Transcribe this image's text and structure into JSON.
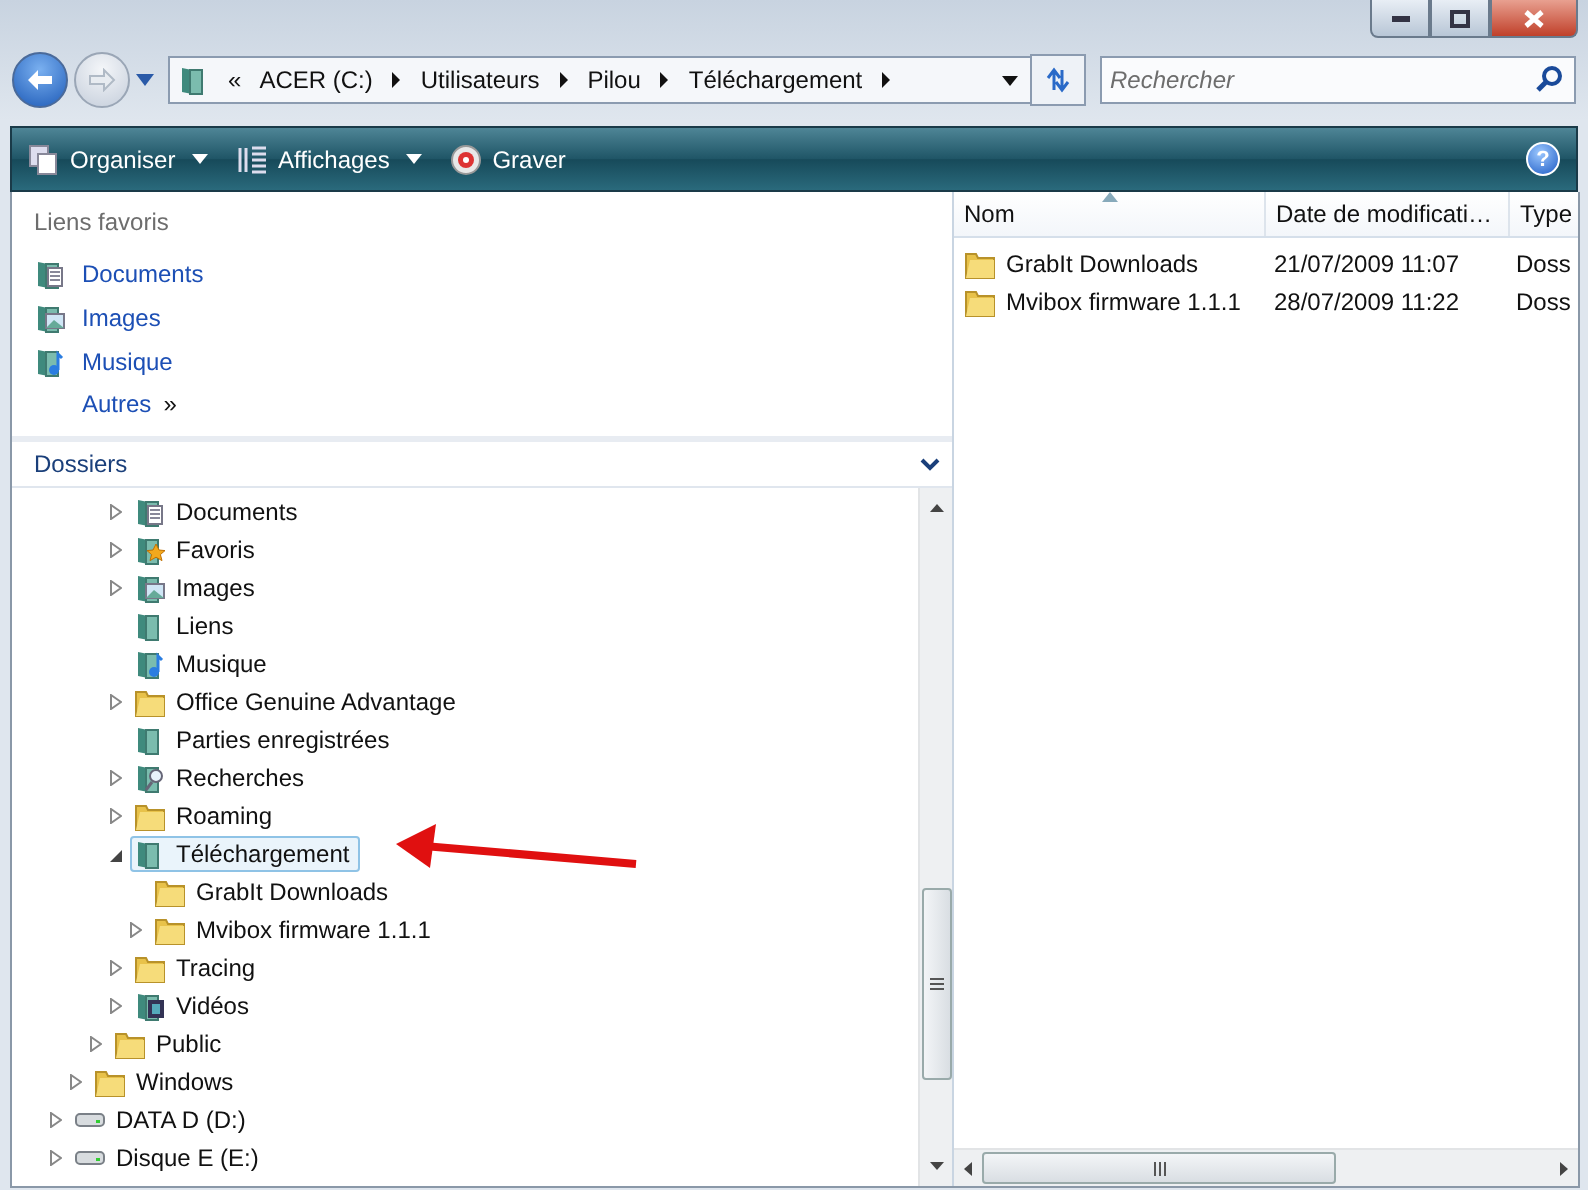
{
  "address_bar": {
    "overflow": "«",
    "crumbs": [
      "ACER (C:)",
      "Utilisateurs",
      "Pilou",
      "Téléchargement"
    ]
  },
  "search": {
    "placeholder": "Rechercher"
  },
  "toolbar": {
    "items": [
      {
        "label": "Organiser",
        "kind": "organize",
        "menu": true
      },
      {
        "label": "Affichages",
        "kind": "views",
        "menu": true
      },
      {
        "label": "Graver",
        "kind": "burn",
        "menu": false
      }
    ],
    "help": "?"
  },
  "favorites": {
    "title": "Liens favoris",
    "items": [
      {
        "label": "Documents",
        "kind": "documents"
      },
      {
        "label": "Images",
        "kind": "pictures"
      },
      {
        "label": "Musique",
        "kind": "music"
      }
    ],
    "more": {
      "label": "Autres",
      "glyph": "»"
    }
  },
  "folders": {
    "title": "Dossiers",
    "tree": [
      {
        "children": [
          {
            "children": [
              {
                "children": [
                  {
                    "label": "Documents",
                    "kind": "documents",
                    "expandable": true,
                    "expanded": false,
                    "selected": false
                  },
                  {
                    "label": "Favoris",
                    "kind": "favorites",
                    "expandable": true,
                    "expanded": false,
                    "selected": false
                  },
                  {
                    "label": "Images",
                    "kind": "pictures",
                    "expandable": true,
                    "expanded": false,
                    "selected": false
                  },
                  {
                    "label": "Liens",
                    "kind": "library",
                    "expandable": false,
                    "selected": false
                  },
                  {
                    "label": "Musique",
                    "kind": "music",
                    "expandable": false,
                    "selected": false
                  },
                  {
                    "label": "Office Genuine Advantage",
                    "kind": "folder",
                    "expandable": true,
                    "expanded": false,
                    "selected": false
                  },
                  {
                    "label": "Parties enregistrées",
                    "kind": "library",
                    "expandable": false,
                    "selected": false
                  },
                  {
                    "label": "Recherches",
                    "kind": "search",
                    "expandable": true,
                    "expanded": false,
                    "selected": false
                  },
                  {
                    "label": "Roaming",
                    "kind": "folder",
                    "expandable": true,
                    "expanded": false,
                    "selected": false
                  },
                  {
                    "label": "Téléchargement",
                    "kind": "library",
                    "expandable": true,
                    "expanded": true,
                    "selected": true,
                    "children": [
                      {
                        "label": "GrabIt Downloads",
                        "kind": "folder",
                        "expandable": false,
                        "selected": false
                      },
                      {
                        "label": "Mvibox firmware 1.1.1",
                        "kind": "folder",
                        "expandable": true,
                        "expanded": false,
                        "selected": false
                      }
                    ]
                  },
                  {
                    "label": "Tracing",
                    "kind": "folder",
                    "expandable": true,
                    "expanded": false,
                    "selected": false
                  },
                  {
                    "label": "Vidéos",
                    "kind": "videos",
                    "expandable": true,
                    "expanded": false,
                    "selected": false
                  }
                ]
              },
              {
                "label": "Public",
                "kind": "folder",
                "expandable": true,
                "expanded": false,
                "selected": false
              }
            ]
          },
          {
            "label": "Windows",
            "kind": "folder",
            "expandable": true,
            "expanded": false,
            "selected": false
          }
        ]
      },
      {
        "label": "DATA D (D:)",
        "kind": "drive",
        "expandable": true,
        "expanded": false,
        "selected": false
      },
      {
        "label": "Disque E (E:)",
        "kind": "drive",
        "expandable": true,
        "expanded": false,
        "selected": false
      }
    ]
  },
  "files": {
    "columns": [
      {
        "label": "Nom",
        "sorted": true
      },
      {
        "label": "Date de modificati…",
        "sorted": false
      },
      {
        "label": "Type",
        "sorted": false
      }
    ],
    "rows": [
      {
        "name": "GrabIt Downloads",
        "date": "21/07/2009 11:07",
        "type": "Doss"
      },
      {
        "name": "Mvibox firmware 1.1.1",
        "date": "28/07/2009 11:22",
        "type": "Doss"
      }
    ]
  }
}
